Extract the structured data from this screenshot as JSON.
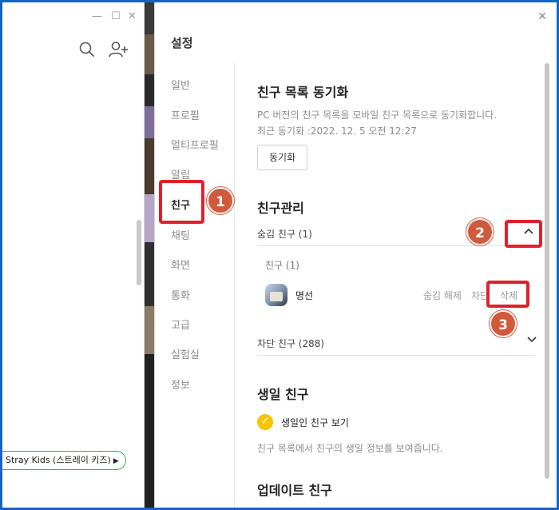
{
  "main_window": {
    "minimize": "—",
    "maximize": "☐",
    "close": "✕",
    "music_status": "Stray Kids (스트레이 키즈)",
    "music_icon": "play-icon"
  },
  "settings": {
    "title": "설정",
    "close": "✕",
    "nav": [
      "일반",
      "프로필",
      "멀티프로필",
      "알림",
      "친구",
      "채팅",
      "화면",
      "통화",
      "고급",
      "실험실",
      "정보"
    ],
    "active_nav": "친구",
    "sync": {
      "heading": "친구 목록 동기화",
      "description": "PC 버전의 친구 목록을 모바일 친구 목록으로 동기화합니다.",
      "last_sync": "최근 동기화 :2022. 12. 5 오전 12:27",
      "button": "동기화"
    },
    "manage": {
      "heading": "친구관리",
      "hidden_label": "숨김 친구 (1)",
      "hidden_sub": "친구 (1)",
      "friend_name": "명선",
      "unhide": "숨김 해제",
      "block": "차단",
      "delete": "삭제",
      "blocked_label": "차단 친구 (288)"
    },
    "birthday": {
      "heading": "생일 친구",
      "toggle_label": "생일인 친구 보기",
      "description": "친구 목록에서 친구의 생일 정보를 보여줍니다."
    },
    "update": {
      "heading": "업데이트 친구"
    }
  },
  "annotations": {
    "step1": "1",
    "step2": "2",
    "step3": "3",
    "highlight_color": "#e0202a",
    "badge_color": "#d25a3c"
  }
}
